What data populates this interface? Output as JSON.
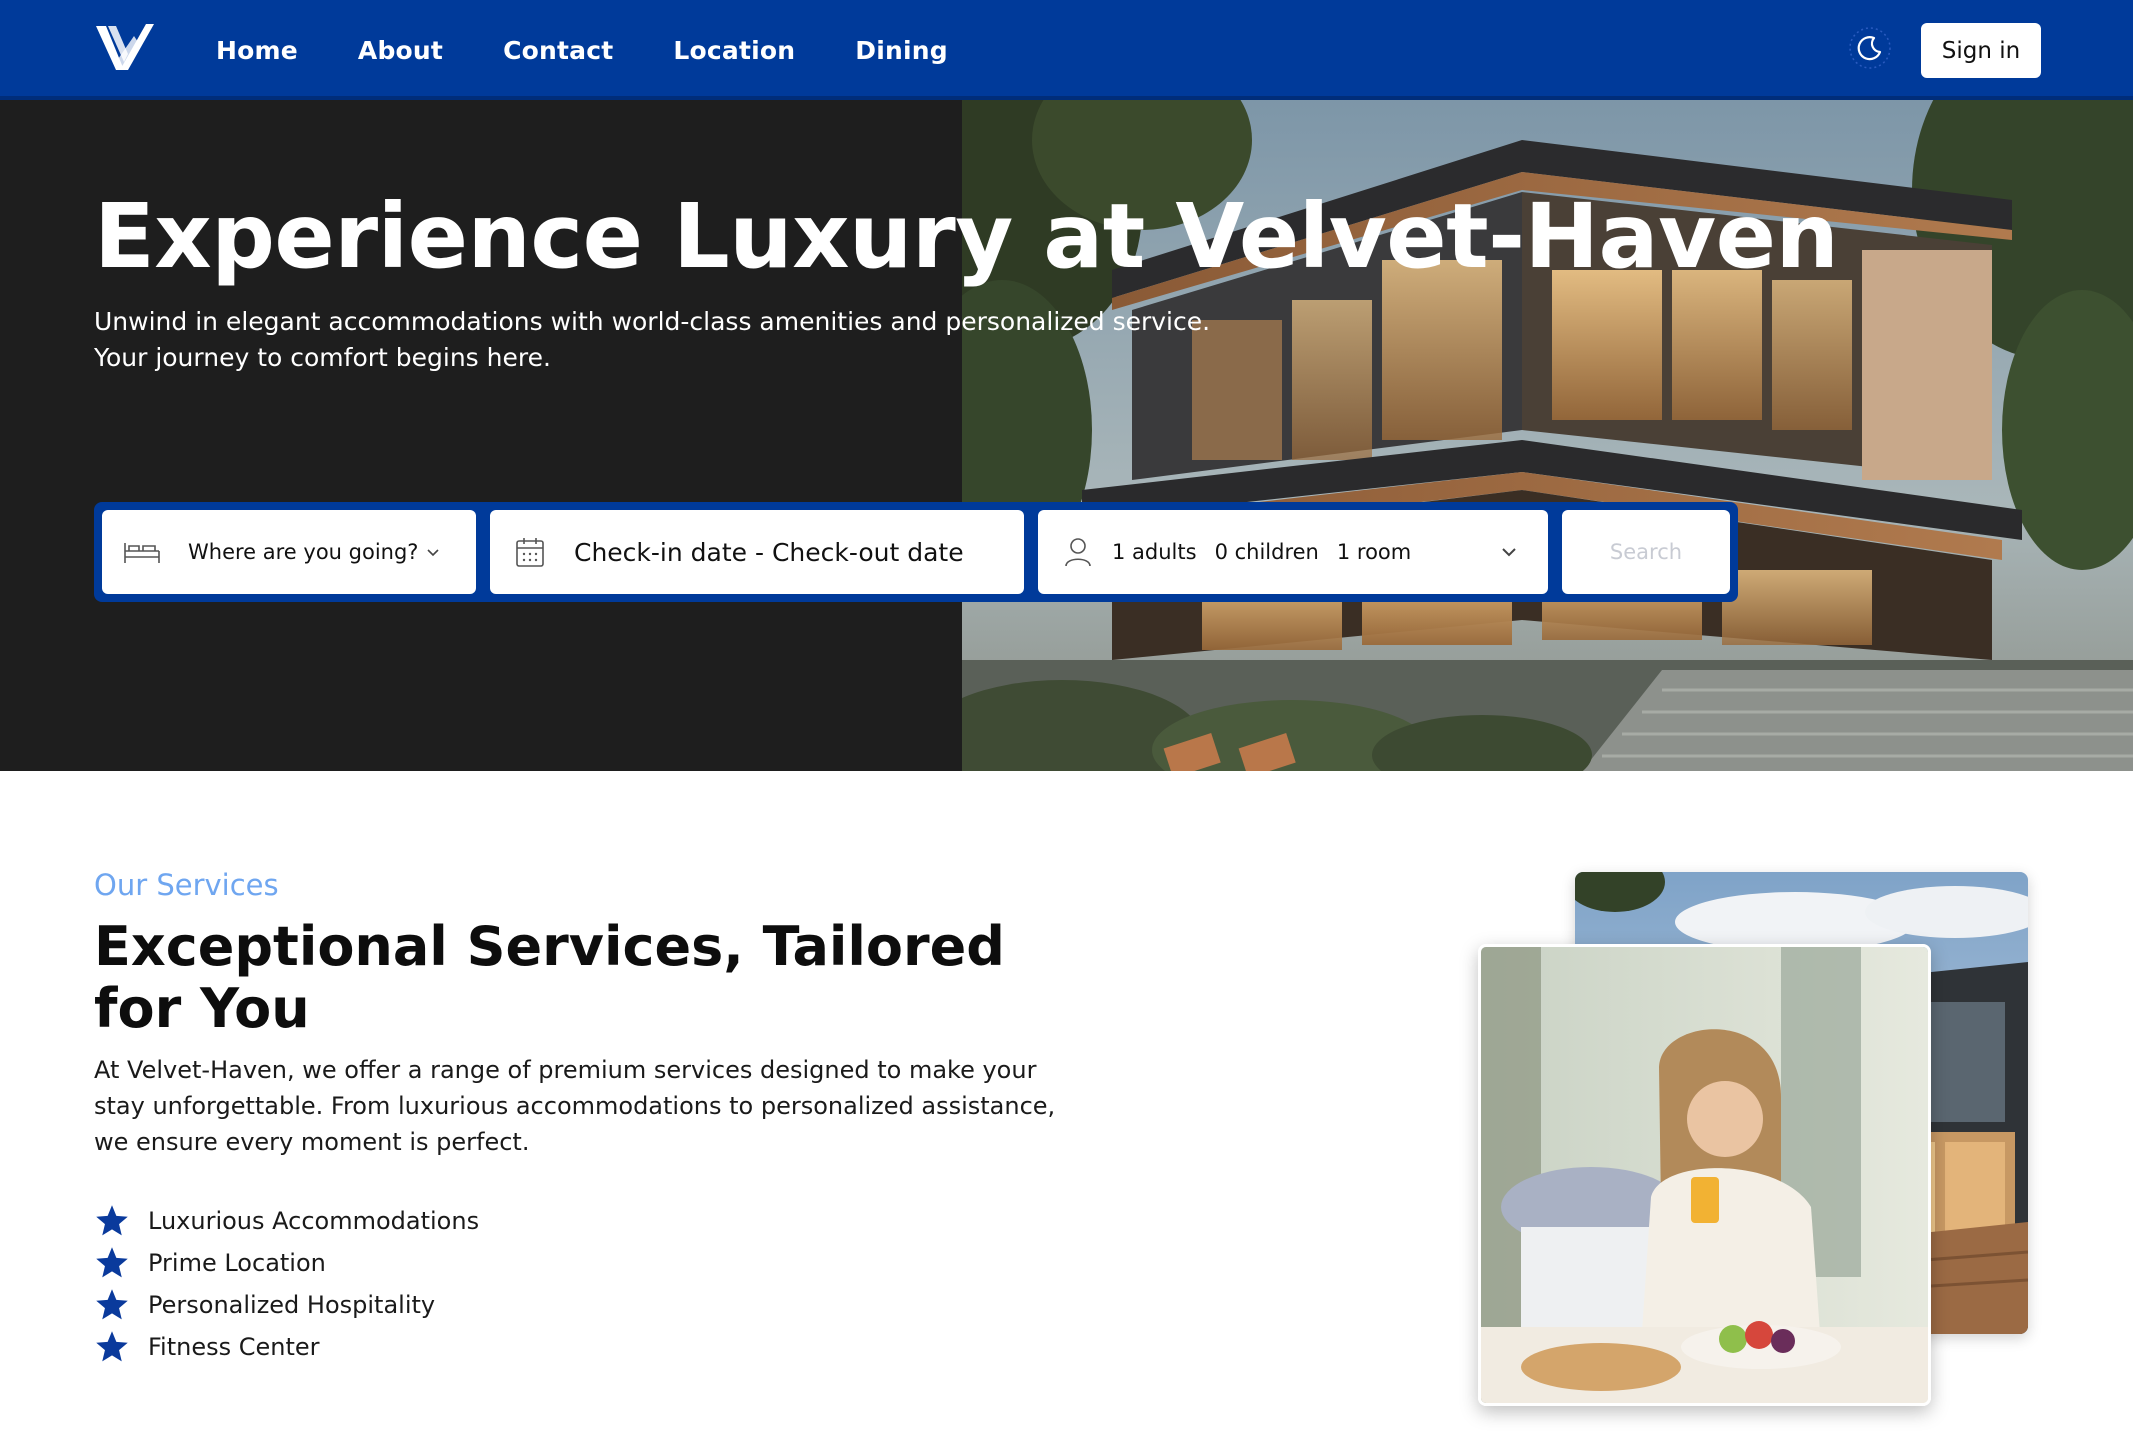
{
  "nav": {
    "links": [
      "Home",
      "About",
      "Contact",
      "Location",
      "Dining"
    ],
    "signin_label": "Sign in",
    "theme_icon": "moon-icon",
    "colors": {
      "nav_bg": "#003a9a",
      "accent": "#003a9a"
    }
  },
  "hero": {
    "title": "Experience Luxury at Velvet-Haven",
    "subtitle": "Unwind in elegant accommodations with world-class amenities and personalized service. Your journey to comfort begins here."
  },
  "search": {
    "destination_placeholder": "Where are you going?",
    "dates_placeholder": "Check-in date - Check-out date",
    "adults": "1 adults",
    "children": "0 children",
    "rooms": "1 room",
    "search_label": "Search"
  },
  "services": {
    "eyebrow": "Our Services",
    "title": "Exceptional Services, Tailored for You",
    "description": "At Velvet-Haven, we offer a range of premium services designed to make your stay unforgettable. From luxurious accommodations to personalized assistance, we ensure every moment is perfect.",
    "features": [
      "Luxurious Accommodations",
      "Prime Location",
      "Personalized Hospitality",
      "Fitness Center"
    ],
    "eyebrow_color": "#6fa6f0"
  }
}
